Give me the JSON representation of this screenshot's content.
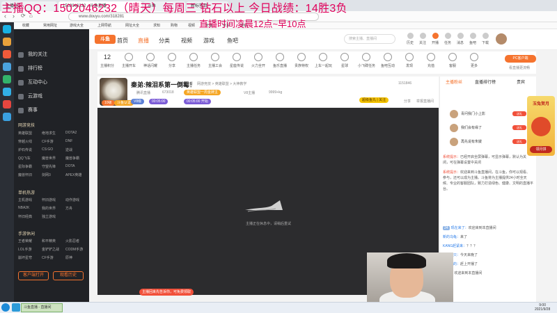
{
  "overlay": {
    "line1": "主播QQ：1502046232（晴天）每周三 钻石以上 今日战绩：14胜3负",
    "line2": "直播时间凌晨12点~早10点"
  },
  "browser": {
    "tabs": [
      "主播QQ...",
      "1502046232 - 斗鱼直播",
      "斗鱼",
      "新标签页"
    ],
    "url": "www.douyu.com/318281",
    "bookmarks": [
      "收藏",
      "常用网址",
      "游戏大全",
      "上网导航",
      "网址大全",
      "求知",
      "购物",
      "视频",
      "天猫",
      "京东",
      "游戏"
    ]
  },
  "leftnav": {
    "items": [
      "我的关注",
      "排行榜",
      "互动中心",
      "云游戏",
      "赛事"
    ],
    "sec_hot": "网游竞技",
    "hot_cells": [
      "英雄联盟",
      "绝地求生",
      "DOTA2",
      "穿越火线",
      "CF手游",
      "DNF",
      "炉石传说",
      "CS:GO",
      "逆战",
      "QQ飞车",
      "魔兽世界",
      "魔兽争霸",
      "星际争霸",
      "守望先锋",
      "DOTA",
      "魔兽怀旧",
      "剑网3",
      "APEX英雄"
    ],
    "sec_mobile": "单机热游",
    "mobile_cells": [
      "主机游戏",
      "怀旧游戏",
      "动作游戏",
      "NBA2K",
      "我的世界",
      "方舟",
      "怀旧经典",
      "独立游戏"
    ],
    "sec_hand": "手游休闲",
    "hand_cells": [
      "王者荣耀",
      "和平精英",
      "火影忍者",
      "LOL手游",
      "金铲铲之战",
      "CODM手游",
      "崩坏星穹",
      "CF手游",
      "原神"
    ],
    "btn_client": "客户端打开",
    "btn_history": "观看历史"
  },
  "header": {
    "logo": "斗鱼",
    "nav": [
      "首页",
      "直播",
      "分类",
      "视频",
      "游戏",
      "鱼吧"
    ],
    "active_nav": "直播",
    "search_placeholder": "搜索主播、直播间",
    "icons": [
      "历史",
      "关注",
      "开播",
      "任务",
      "消息",
      "鱼吧",
      "下载"
    ]
  },
  "categories": [
    {
      "label": "主播积分",
      "num": "12"
    },
    {
      "label": "主播开车"
    },
    {
      "label": "神话闪耀"
    },
    {
      "label": "分享"
    },
    {
      "label": "主播任务"
    },
    {
      "label": "主播工会"
    },
    {
      "label": "星座传说"
    },
    {
      "label": "火力全开"
    },
    {
      "label": "鱼乐直播"
    },
    {
      "label": "贵族特权"
    },
    {
      "label": "上车一起玩"
    },
    {
      "label": "星球"
    },
    {
      "label": "小飞碟任务"
    },
    {
      "label": "鱼吧互动"
    },
    {
      "label": "发现"
    },
    {
      "label": "充值"
    },
    {
      "label": "客服"
    },
    {
      "label": "更多"
    }
  ],
  "pc_btn": "PC客户端",
  "pc_sub": "看直播更流畅",
  "room": {
    "title": "秦弟:辣泪系第一倒霉！",
    "meta1": "举报",
    "meta2": "网游竞技 > 英雄联盟 > 大神教学",
    "host": "腾讯直播",
    "room_id": "673018",
    "rank_badge": "英雄联盟一周金牌主",
    "hot": "9999+kg",
    "follow_count": "1151846",
    "badge_level": "10级",
    "vod_badge": "V8主播",
    "fans_badge": "斗鱼认证",
    "tags": [
      "V8级",
      "00:05:00",
      "00:05:00 开始"
    ],
    "fans_btn": "超级鱼丸 | 关注",
    "share": "分享",
    "report": "举报直播间"
  },
  "video": {
    "status": "主播正在休息中，请稍后重试",
    "tip": "主播回来先告诉你，可免费领取"
  },
  "rightpanel": {
    "tabs": [
      "主播粉丝",
      "直播排行榜",
      "贵宾"
    ],
    "rank": [
      {
        "name": "青问我门小上影",
        "badge": "送礼"
      },
      {
        "name": "我们会有缘了",
        "badge": "送礼"
      },
      {
        "name": "再先说有朱媛",
        "badge": "送礼"
      }
    ],
    "sys": [
      {
        "tag": "系统提示：",
        "text": "已经开启全屏弹幕，可显示弹幕，默认为关闭，可在弹幕设置中关闭"
      },
      {
        "tag": "系统提示：",
        "text": "欢迎来到斗鱼直播间，在斗鱼，你可以观看、参与，还可以成为主播。斗鱼将为主播提供24小时全天候、专业的客服团队，致力打造绿色、健康、文明的直播平台。"
      }
    ],
    "chat": [
      {
        "lvl": "24",
        "user": "现在来了：",
        "msg": "欢迎来到本直播间"
      },
      {
        "lvl": "",
        "user": "新的乌龟：",
        "msg": "来了"
      },
      {
        "lvl": "",
        "user": "KANG赶紧来：",
        "msg": "？？？"
      },
      {
        "lvl": "",
        "user": "小鱼一只：",
        "msg": "今天来晚了"
      },
      {
        "lvl": "",
        "user": "来伴手的：",
        "msg": "赶上开播了"
      },
      {
        "lvl": "",
        "user": "lucky：",
        "msg": "欢迎来到本直播间"
      }
    ],
    "promo": "玉兔贺月",
    "promo_btn": "领月饼"
  },
  "taskbar": {
    "task": "斗鱼直播 - 直播间",
    "time": "9:00",
    "date": "2021/9/28"
  }
}
